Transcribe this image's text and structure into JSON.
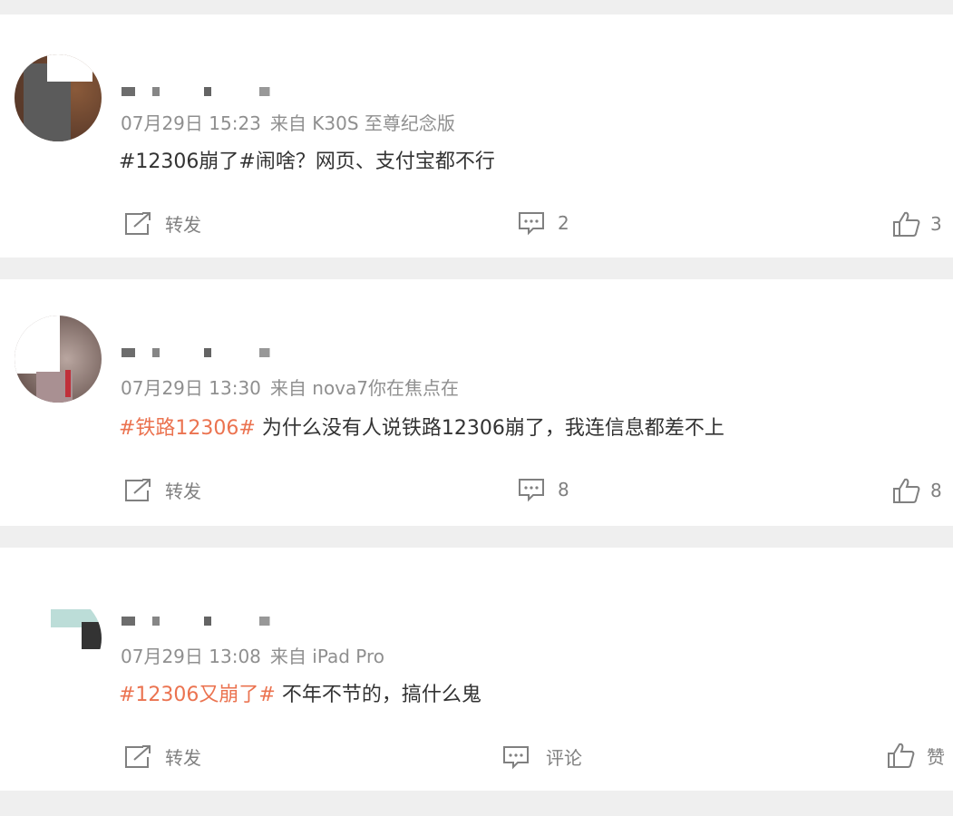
{
  "posts": [
    {
      "time": "07月29日 15:23",
      "source": "来自 K30S 至尊纪念版",
      "tag": "",
      "text": "#12306崩了#闹啥？网页、支付宝都不行",
      "repost_label": "转发",
      "comment_count": "2",
      "like_count": "3"
    },
    {
      "time": "07月29日 13:30",
      "source": "来自 nova7你在焦点在",
      "tag": "#铁路12306#",
      "text": " 为什么没有人说铁路12306崩了，我连信息都差不上",
      "repost_label": "转发",
      "comment_count": "8",
      "like_count": "8"
    },
    {
      "time": "07月29日 13:08",
      "source": "来自 iPad Pro",
      "tag": "#12306又崩了#",
      "text": " 不年不节的，搞什么鬼",
      "repost_label": "转发",
      "comment_count": "评论",
      "like_count": "赞"
    }
  ],
  "colors": {
    "tag": "#eb7350",
    "meta": "#8f8f8f",
    "text": "#333333",
    "background": "#efefef"
  },
  "icons": [
    "repost-icon",
    "comment-icon",
    "like-icon"
  ]
}
